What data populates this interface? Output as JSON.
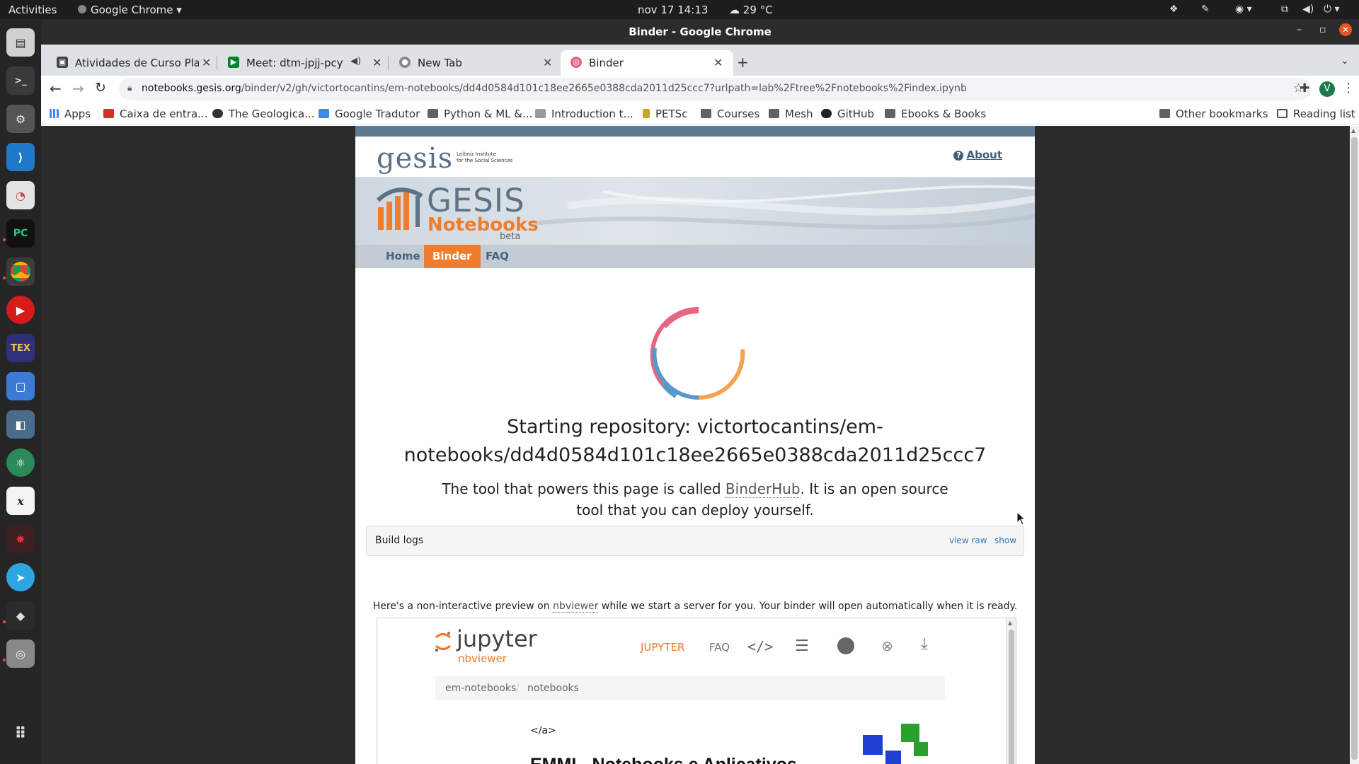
{
  "topbar": {
    "activities": "Activities",
    "app_menu": "Google Chrome",
    "datetime": "nov 17  14:13",
    "weather": "29 °C"
  },
  "window": {
    "title": "Binder - Google Chrome"
  },
  "tabs": [
    {
      "label": "Atividades de Curso Planej",
      "icon": "classroom-icon"
    },
    {
      "label": "Meet: dtm-jpjj-pcy",
      "icon": "meet-icon"
    },
    {
      "label": "New Tab",
      "icon": "chrome-icon"
    },
    {
      "label": "Binder",
      "icon": "binder-icon"
    }
  ],
  "omnibox": {
    "domain": "notebooks.gesis.org",
    "path": "/binder/v2/gh/victortocantins/em-notebooks/dd4d0584d101c18ee2665e0388cda2011d25ccc7?urlpath=lab%2Ftree%2Fnotebooks%2Findex.ipynb"
  },
  "profile_letter": "V",
  "bookmarks": [
    {
      "label": "Apps",
      "icon": "apps-icon"
    },
    {
      "label": "Caixa de entra...",
      "icon": "gmail-icon"
    },
    {
      "label": "The Geologica...",
      "icon": "site-icon"
    },
    {
      "label": "Google Tradutor",
      "icon": "translate-icon"
    },
    {
      "label": "Python & ML &...",
      "icon": "folder-icon"
    },
    {
      "label": "Introduction t...",
      "icon": "site-icon"
    },
    {
      "label": "PETSc",
      "icon": "site-icon"
    },
    {
      "label": "Courses",
      "icon": "folder-icon"
    },
    {
      "label": "Mesh",
      "icon": "folder-icon"
    },
    {
      "label": "GitHub",
      "icon": "github-icon"
    },
    {
      "label": "Ebooks & Books",
      "icon": "folder-icon"
    }
  ],
  "bookmarks_right": {
    "other": "Other bookmarks",
    "reading": "Reading list"
  },
  "gesis": {
    "logo": "gesis",
    "leibniz_line1": "Leibniz Institute",
    "leibniz_line2": "for the Social Sciences",
    "about": "About",
    "banner_title": "GESIS",
    "banner_sub": "Notebooks",
    "banner_beta": "beta",
    "nav": [
      "Home",
      "Binder",
      "FAQ"
    ]
  },
  "binder": {
    "status_line1": "Starting repository: victortocantins/em-",
    "status_line2": "notebooks/dd4d0584d101c18ee2665e0388cda2011d25ccc7",
    "powered_a": "The tool that powers this page is called ",
    "powered_link": "BinderHub",
    "powered_b": ". It is an open source",
    "powered_c": "tool that you can deploy yourself.",
    "build_logs": "Build logs",
    "view_raw": "view raw",
    "show": "show",
    "preview_a": "Here's a non-interactive preview on ",
    "preview_link": "nbviewer",
    "preview_b": " while we start a server for you. Your binder will open automatically when it is ready."
  },
  "nbviewer": {
    "logo_main": "jupyter",
    "logo_sub": "nbviewer",
    "nav_jupyter": "JUPYTER",
    "nav_faq": "FAQ",
    "breadcrumb": [
      "em-notebooks",
      "notebooks"
    ],
    "code_text": "</a>",
    "heading": "EMMI - Notebooks e Aplicativos"
  },
  "colors": {
    "accent_orange": "#ef7d2e",
    "gesis_blue": "#5b7187",
    "jupyter_orange": "#f37726"
  }
}
